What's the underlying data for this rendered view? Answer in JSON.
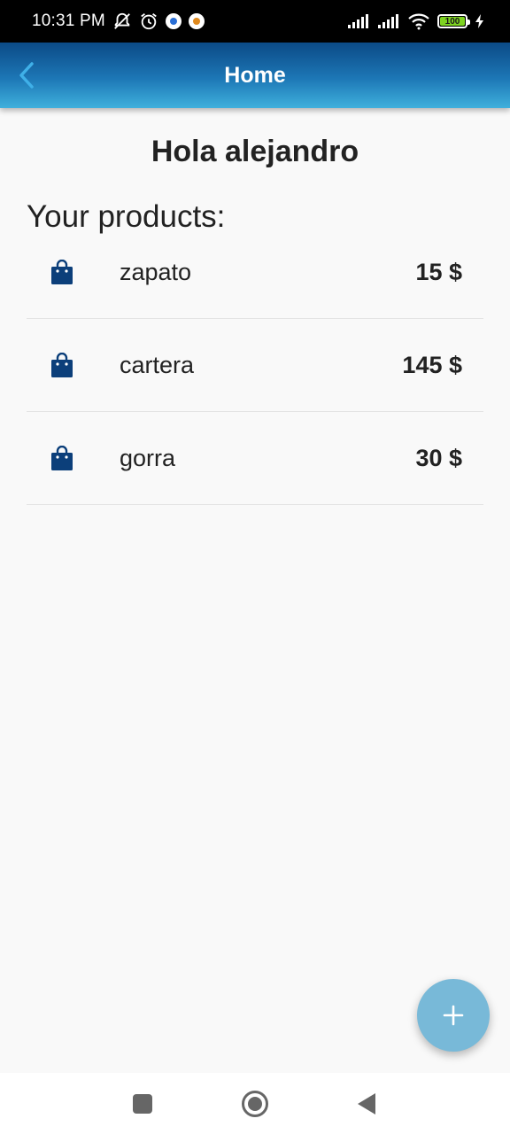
{
  "status_bar": {
    "time": "10:31 PM",
    "battery_level": "100",
    "icons": [
      "muted-notification-icon",
      "alarm-icon",
      "app-notification-icon",
      "app-notification-icon-2",
      "signal-icon",
      "signal-icon-2",
      "wifi-icon",
      "battery-icon",
      "charging-icon"
    ]
  },
  "app_bar": {
    "title": "Home",
    "back_icon": "chevron-left-icon"
  },
  "greeting": "Hola alejandro",
  "products_heading": "Your products:",
  "products": [
    {
      "name": "zapato",
      "price": "15 $",
      "icon": "shopping-bag-icon"
    },
    {
      "name": "cartera",
      "price": "145 $",
      "icon": "shopping-bag-icon"
    },
    {
      "name": "gorra",
      "price": "30 $",
      "icon": "shopping-bag-icon"
    }
  ],
  "fab": {
    "icon": "plus-icon"
  },
  "colors": {
    "app_bar_top": "#0b4a86",
    "app_bar_bottom": "#3fb0dc",
    "bag_icon": "#0c3f7a",
    "fab": "#78b9d8",
    "background": "#f9f9f9"
  },
  "nav_bar": {
    "icons": [
      "recent-apps-icon",
      "home-icon",
      "back-icon"
    ]
  }
}
